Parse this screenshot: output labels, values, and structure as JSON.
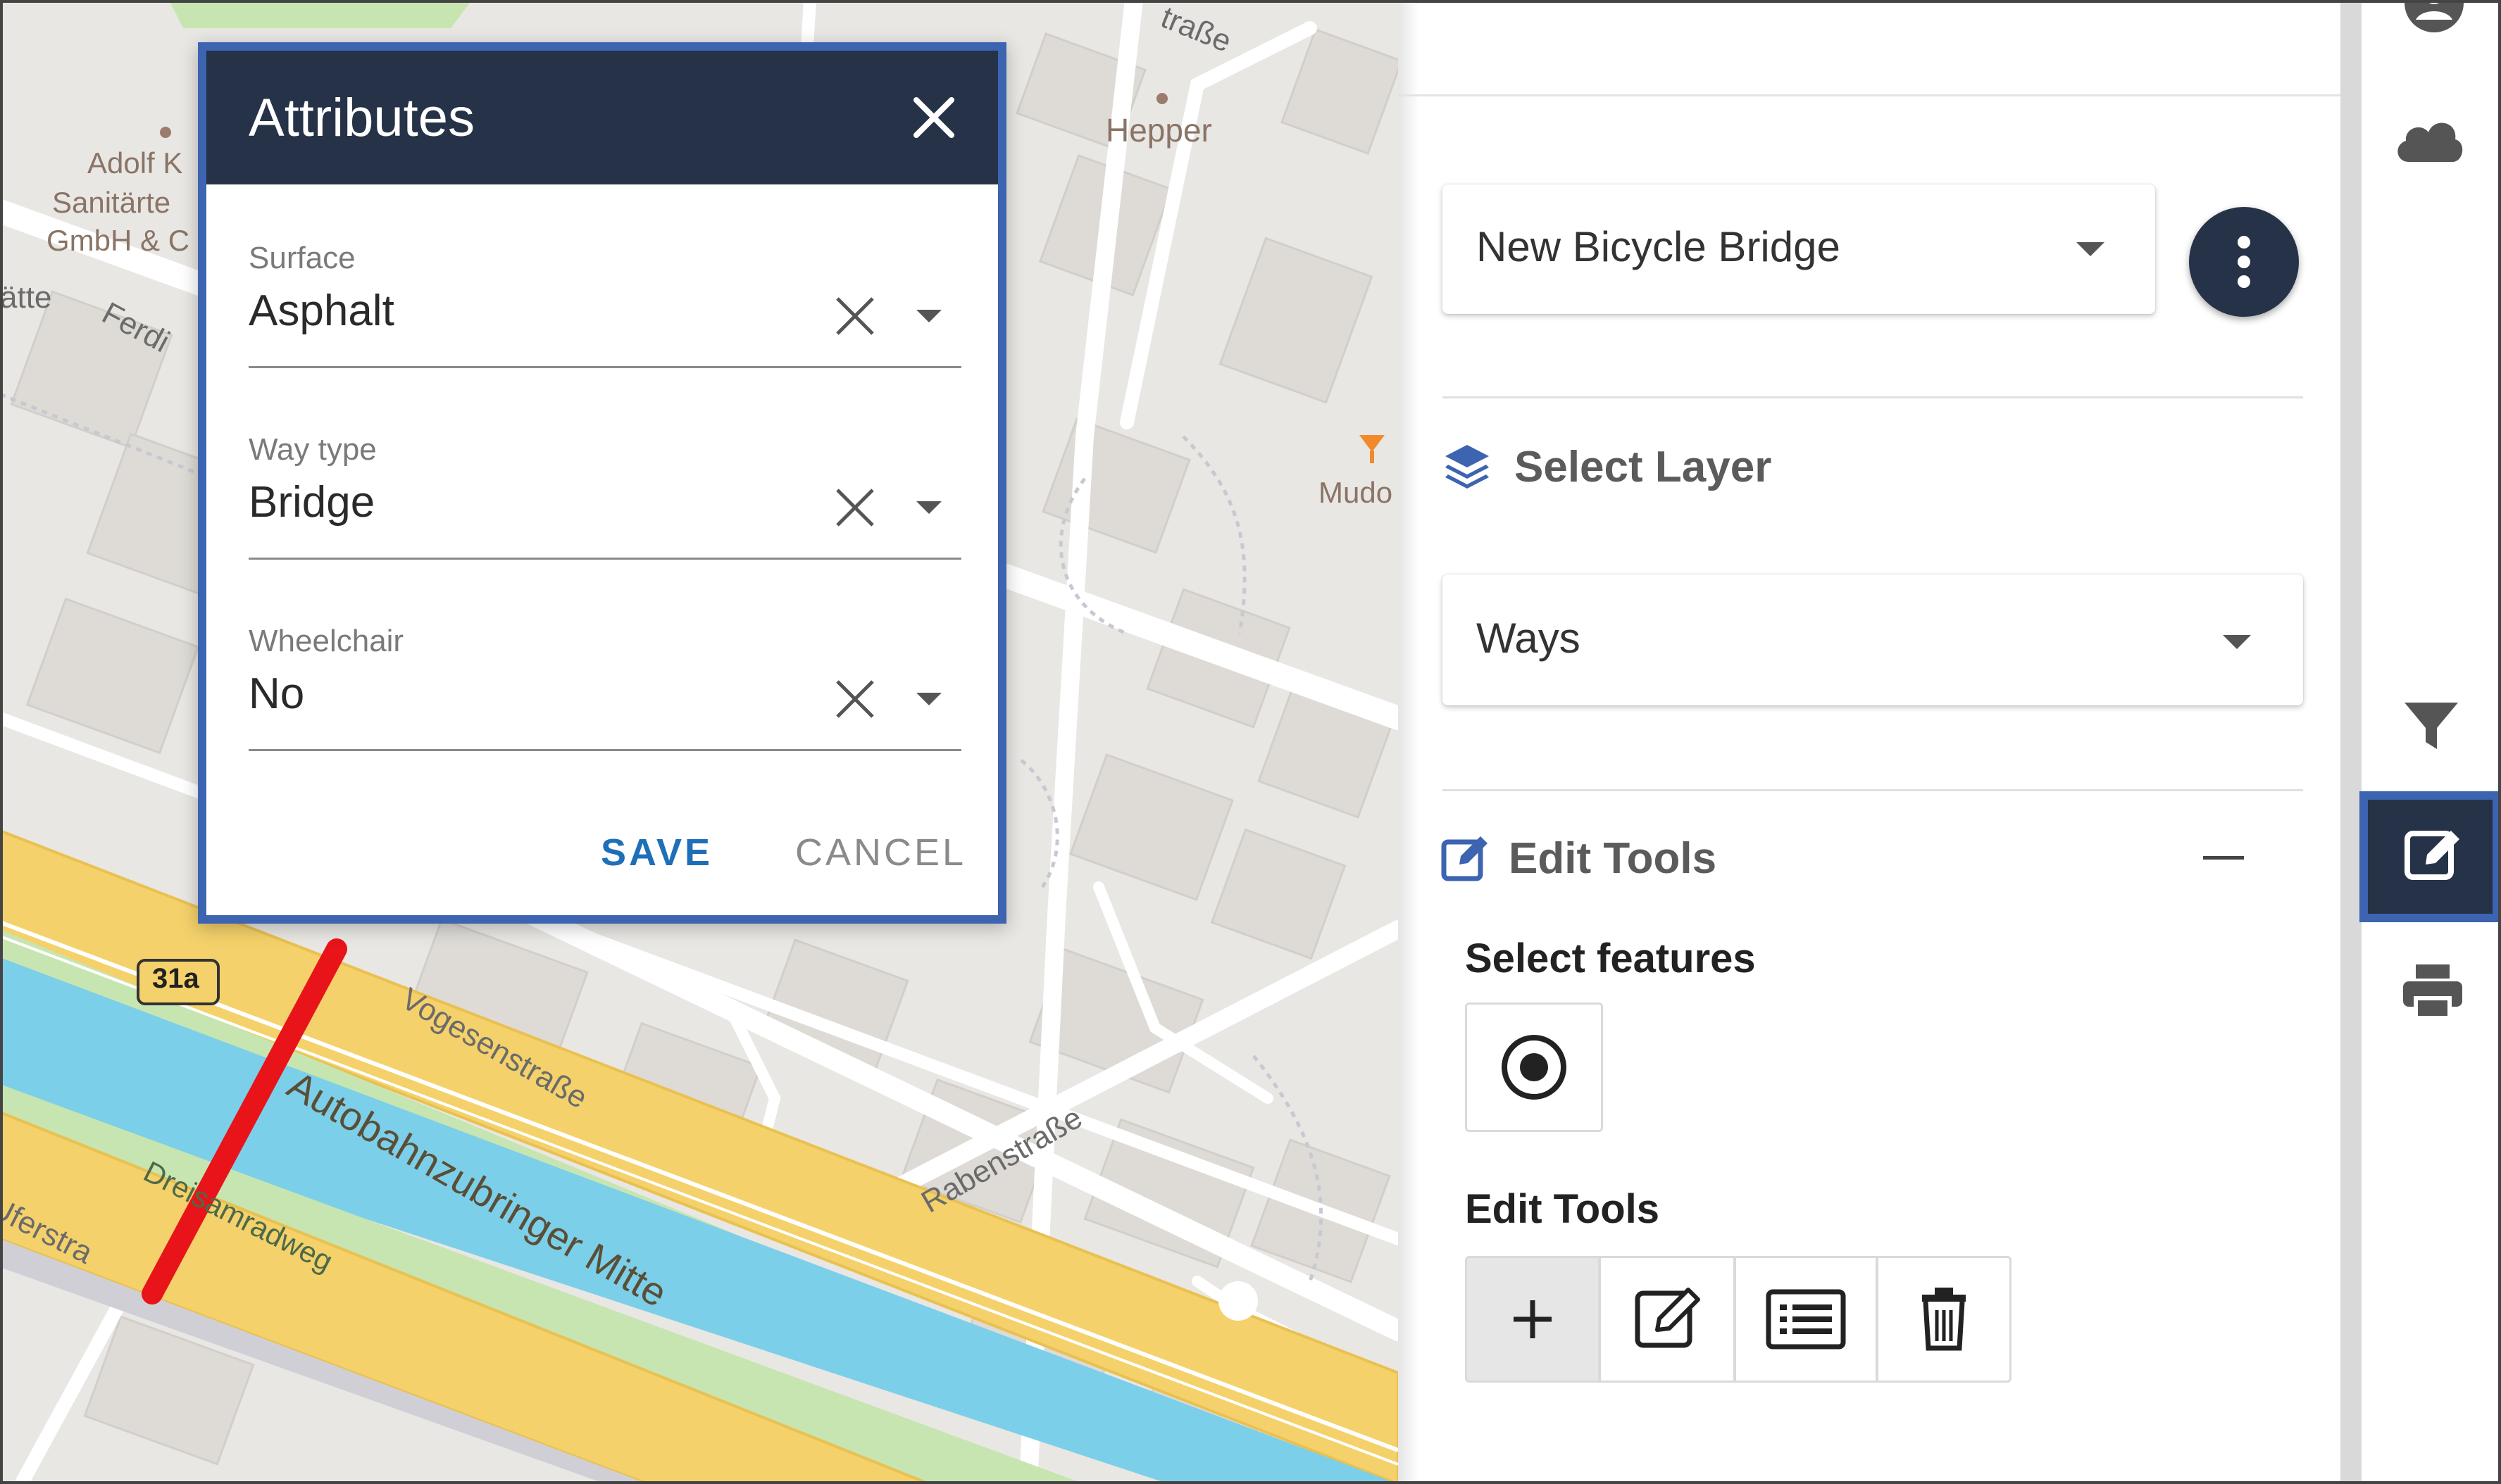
{
  "map": {
    "labels": {
      "poi_1": "Adolf K",
      "poi_2": "Sanitärte",
      "poi_3": "GmbH & C",
      "hepper": "Hepper",
      "mudo": "Mudo",
      "atte": "ätte",
      "ferdi": "Ferdi",
      "strasse_top": "traße",
      "vogesen": "Vogesenstraße",
      "autobahn": "Autobahnzubringer Mitte",
      "dreisam": "Dreisamradweg",
      "uferstr": "Uferstra",
      "raben": "Rabenstraße",
      "route_shield": "31a"
    }
  },
  "dialog": {
    "title": "Attributes",
    "fields": [
      {
        "label": "Surface",
        "value": "Asphalt"
      },
      {
        "label": "Way type",
        "value": "Bridge"
      },
      {
        "label": "Wheelchair",
        "value": "No"
      }
    ],
    "save_label": "SAVE",
    "cancel_label": "CANCEL"
  },
  "panel": {
    "project_select": "New Bicycle Bridge",
    "select_layer_title": "Select Layer",
    "layer_select": "Ways",
    "edit_tools_title": "Edit Tools",
    "select_features_title": "Select features",
    "edit_tools_subtitle": "Edit Tools"
  },
  "rail": {
    "icons": [
      "user-icon",
      "cloud-icon",
      "filter-icon",
      "edit-icon",
      "print-icon"
    ],
    "active": "edit-icon"
  },
  "colors": {
    "header_dark": "#263247",
    "highlight_blue": "#3c64b1",
    "save_blue": "#1f6fb8",
    "bridge_red": "#e8141a",
    "water": "#7ccfe9",
    "highway": "#f4d16a"
  }
}
